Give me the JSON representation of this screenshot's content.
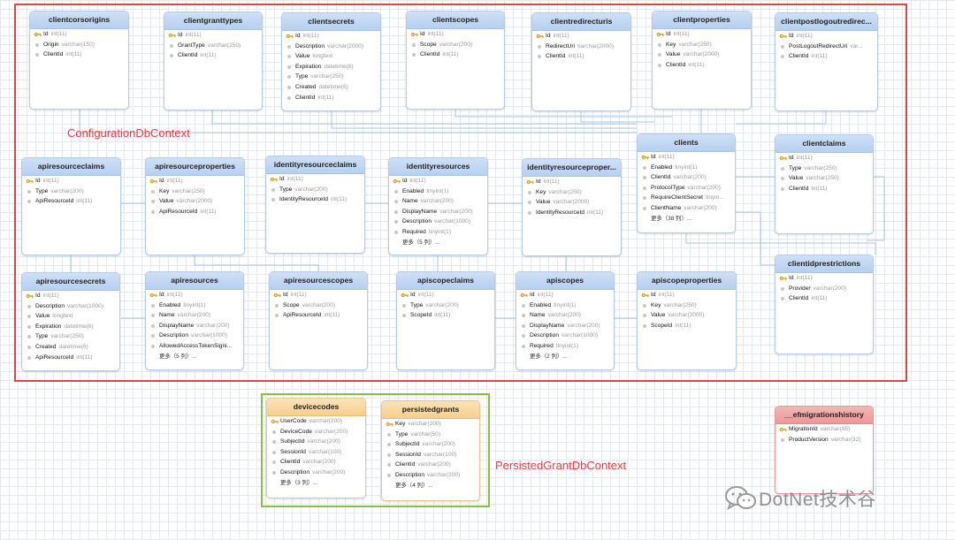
{
  "groups": [
    {
      "id": "cfg",
      "label": "ConfigurationDbContext",
      "color": "#e64343"
    },
    {
      "id": "pg",
      "label": "PersistedGrantDbContext",
      "color": "#e64343",
      "border_color": "#88c23a"
    }
  ],
  "tables": [
    {
      "name": "clientcorsorigins",
      "style": "blue",
      "columns": [
        {
          "name": "Id",
          "type": "int(11)",
          "key": true
        },
        {
          "name": "Origin",
          "type": "varchar(150)"
        },
        {
          "name": "ClientId",
          "type": "int(11)"
        }
      ]
    },
    {
      "name": "clientgranttypes",
      "style": "blue",
      "columns": [
        {
          "name": "Id",
          "type": "int(11)",
          "key": true
        },
        {
          "name": "GrantType",
          "type": "varchar(250)"
        },
        {
          "name": "ClientId",
          "type": "int(11)"
        }
      ]
    },
    {
      "name": "clientsecrets",
      "style": "blue",
      "columns": [
        {
          "name": "Id",
          "type": "int(11)",
          "key": true
        },
        {
          "name": "Description",
          "type": "varchar(2000)"
        },
        {
          "name": "Value",
          "type": "longtext"
        },
        {
          "name": "Expiration",
          "type": "datetime(6)"
        },
        {
          "name": "Type",
          "type": "varchar(250)"
        },
        {
          "name": "Created",
          "type": "datetime(6)"
        },
        {
          "name": "ClientId",
          "type": "int(11)"
        }
      ]
    },
    {
      "name": "clientscopes",
      "style": "blue",
      "columns": [
        {
          "name": "Id",
          "type": "int(11)",
          "key": true
        },
        {
          "name": "Scope",
          "type": "varchar(200)"
        },
        {
          "name": "ClientId",
          "type": "int(11)"
        }
      ]
    },
    {
      "name": "clientredirecturis",
      "style": "blue",
      "columns": [
        {
          "name": "Id",
          "type": "int(11)",
          "key": true
        },
        {
          "name": "RedirectUri",
          "type": "varchar(2000)"
        },
        {
          "name": "ClientId",
          "type": "int(11)"
        }
      ]
    },
    {
      "name": "clientproperties",
      "style": "blue",
      "columns": [
        {
          "name": "Id",
          "type": "int(11)",
          "key": true
        },
        {
          "name": "Key",
          "type": "varchar(250)"
        },
        {
          "name": "Value",
          "type": "varchar(2000)"
        },
        {
          "name": "ClientId",
          "type": "int(11)"
        }
      ]
    },
    {
      "name": "clientpostlogoutredirec...",
      "style": "blue",
      "columns": [
        {
          "name": "Id",
          "type": "int(11)",
          "key": true
        },
        {
          "name": "PostLogoutRedirectUri",
          "type": "var..."
        },
        {
          "name": "ClientId",
          "type": "int(11)"
        }
      ]
    },
    {
      "name": "clients",
      "style": "blue",
      "columns": [
        {
          "name": "Id",
          "type": "int(11)",
          "key": true
        },
        {
          "name": "Enabled",
          "type": "tinyint(1)"
        },
        {
          "name": "ClientId",
          "type": "varchar(200)"
        },
        {
          "name": "ProtocolType",
          "type": "varchar(200)"
        },
        {
          "name": "RequireClientSecret",
          "type": "tinyin..."
        },
        {
          "name": "ClientName",
          "type": "varchar(200)"
        }
      ],
      "more": "更多（38 列）..."
    },
    {
      "name": "clientclaims",
      "style": "blue",
      "columns": [
        {
          "name": "Id",
          "type": "int(11)",
          "key": true
        },
        {
          "name": "Type",
          "type": "varchar(250)"
        },
        {
          "name": "Value",
          "type": "varchar(250)"
        },
        {
          "name": "ClientId",
          "type": "int(11)"
        }
      ]
    },
    {
      "name": "apiresourceclaims",
      "style": "blue",
      "columns": [
        {
          "name": "Id",
          "type": "int(11)",
          "key": true
        },
        {
          "name": "Type",
          "type": "varchar(200)"
        },
        {
          "name": "ApiResourceId",
          "type": "int(11)"
        }
      ]
    },
    {
      "name": "apiresourceproperties",
      "style": "blue",
      "columns": [
        {
          "name": "Id",
          "type": "int(11)",
          "key": true
        },
        {
          "name": "Key",
          "type": "varchar(250)"
        },
        {
          "name": "Value",
          "type": "varchar(2000)"
        },
        {
          "name": "ApiResourceId",
          "type": "int(11)"
        }
      ]
    },
    {
      "name": "identityresourceclaims",
      "style": "blue",
      "columns": [
        {
          "name": "Id",
          "type": "int(11)",
          "key": true
        },
        {
          "name": "Type",
          "type": "varchar(200)"
        },
        {
          "name": "IdentityResourceId",
          "type": "int(11)"
        }
      ]
    },
    {
      "name": "identityresources",
      "style": "blue",
      "columns": [
        {
          "name": "Id",
          "type": "int(11)",
          "key": true
        },
        {
          "name": "Enabled",
          "type": "tinyint(1)"
        },
        {
          "name": "Name",
          "type": "varchar(200)"
        },
        {
          "name": "DisplayName",
          "type": "varchar(200)"
        },
        {
          "name": "Description",
          "type": "varchar(1000)"
        },
        {
          "name": "Required",
          "type": "tinyint(1)"
        }
      ],
      "more": "更多（5 列）..."
    },
    {
      "name": "identityresourceproper...",
      "style": "blue",
      "columns": [
        {
          "name": "Id",
          "type": "int(11)",
          "key": true
        },
        {
          "name": "Key",
          "type": "varchar(250)"
        },
        {
          "name": "Value",
          "type": "varchar(2000)"
        },
        {
          "name": "IdentityResourceId",
          "type": "int(11)"
        }
      ]
    },
    {
      "name": "clientidprestrictions",
      "style": "blue",
      "columns": [
        {
          "name": "Id",
          "type": "int(11)",
          "key": true
        },
        {
          "name": "Provider",
          "type": "varchar(200)"
        },
        {
          "name": "ClientId",
          "type": "int(11)"
        }
      ]
    },
    {
      "name": "apiresourcesecrets",
      "style": "blue",
      "columns": [
        {
          "name": "Id",
          "type": "int(11)",
          "key": true
        },
        {
          "name": "Description",
          "type": "varchar(1000)"
        },
        {
          "name": "Value",
          "type": "longtext"
        },
        {
          "name": "Expiration",
          "type": "datetime(6)"
        },
        {
          "name": "Type",
          "type": "varchar(250)"
        },
        {
          "name": "Created",
          "type": "datetime(6)"
        },
        {
          "name": "ApiResourceId",
          "type": "int(11)"
        }
      ]
    },
    {
      "name": "apiresources",
      "style": "blue",
      "columns": [
        {
          "name": "Id",
          "type": "int(11)",
          "key": true
        },
        {
          "name": "Enabled",
          "type": "tinyint(1)"
        },
        {
          "name": "Name",
          "type": "varchar(200)"
        },
        {
          "name": "DisplayName",
          "type": "varchar(200)"
        },
        {
          "name": "Description",
          "type": "varchar(1000)"
        },
        {
          "name": "AllowedAccessTokenSigni...",
          "type": ""
        }
      ],
      "more": "更多（5 列）..."
    },
    {
      "name": "apiresourcescopes",
      "style": "blue",
      "columns": [
        {
          "name": "Id",
          "type": "int(11)",
          "key": true
        },
        {
          "name": "Scope",
          "type": "varchar(200)"
        },
        {
          "name": "ApiResourceId",
          "type": "int(11)"
        }
      ]
    },
    {
      "name": "apiscopeclaims",
      "style": "blue",
      "columns": [
        {
          "name": "Id",
          "type": "int(11)",
          "key": true
        },
        {
          "name": "Type",
          "type": "varchar(200)"
        },
        {
          "name": "ScopeId",
          "type": "int(11)"
        }
      ]
    },
    {
      "name": "apiscopes",
      "style": "blue",
      "columns": [
        {
          "name": "Id",
          "type": "int(11)",
          "key": true
        },
        {
          "name": "Enabled",
          "type": "tinyint(1)"
        },
        {
          "name": "Name",
          "type": "varchar(200)"
        },
        {
          "name": "DisplayName",
          "type": "varchar(200)"
        },
        {
          "name": "Description",
          "type": "varchar(1000)"
        },
        {
          "name": "Required",
          "type": "tinyint(1)"
        }
      ],
      "more": "更多（2 列）..."
    },
    {
      "name": "apiscopeproperties",
      "style": "blue",
      "columns": [
        {
          "name": "Id",
          "type": "int(11)",
          "key": true
        },
        {
          "name": "Key",
          "type": "varchar(250)"
        },
        {
          "name": "Value",
          "type": "varchar(2000)"
        },
        {
          "name": "ScopeId",
          "type": "int(11)"
        }
      ]
    },
    {
      "name": "devicecodes",
      "style": "orange",
      "columns": [
        {
          "name": "UserCode",
          "type": "varchar(200)",
          "key": true
        },
        {
          "name": "DeviceCode",
          "type": "varchar(200)"
        },
        {
          "name": "SubjectId",
          "type": "varchar(200)"
        },
        {
          "name": "SessionId",
          "type": "varchar(100)"
        },
        {
          "name": "ClientId",
          "type": "varchar(200)"
        },
        {
          "name": "Description",
          "type": "varchar(200)"
        }
      ],
      "more": "更多（3 列）..."
    },
    {
      "name": "persistedgrants",
      "style": "orange",
      "columns": [
        {
          "name": "Key",
          "type": "varchar(200)",
          "key": true
        },
        {
          "name": "Type",
          "type": "varchar(50)"
        },
        {
          "name": "SubjectId",
          "type": "varchar(200)"
        },
        {
          "name": "SessionId",
          "type": "varchar(100)"
        },
        {
          "name": "ClientId",
          "type": "varchar(200)"
        },
        {
          "name": "Description",
          "type": "varchar(200)"
        }
      ],
      "more": "更多（4 列）..."
    },
    {
      "name": "__efmigrationshistory",
      "style": "pink",
      "columns": [
        {
          "name": "MigrationId",
          "type": "varchar(95)",
          "key": true
        },
        {
          "name": "ProductVersion",
          "type": "varchar(32)"
        }
      ]
    }
  ],
  "watermark": {
    "text": "DotNet技术谷",
    "icon": "wechat-icon"
  }
}
